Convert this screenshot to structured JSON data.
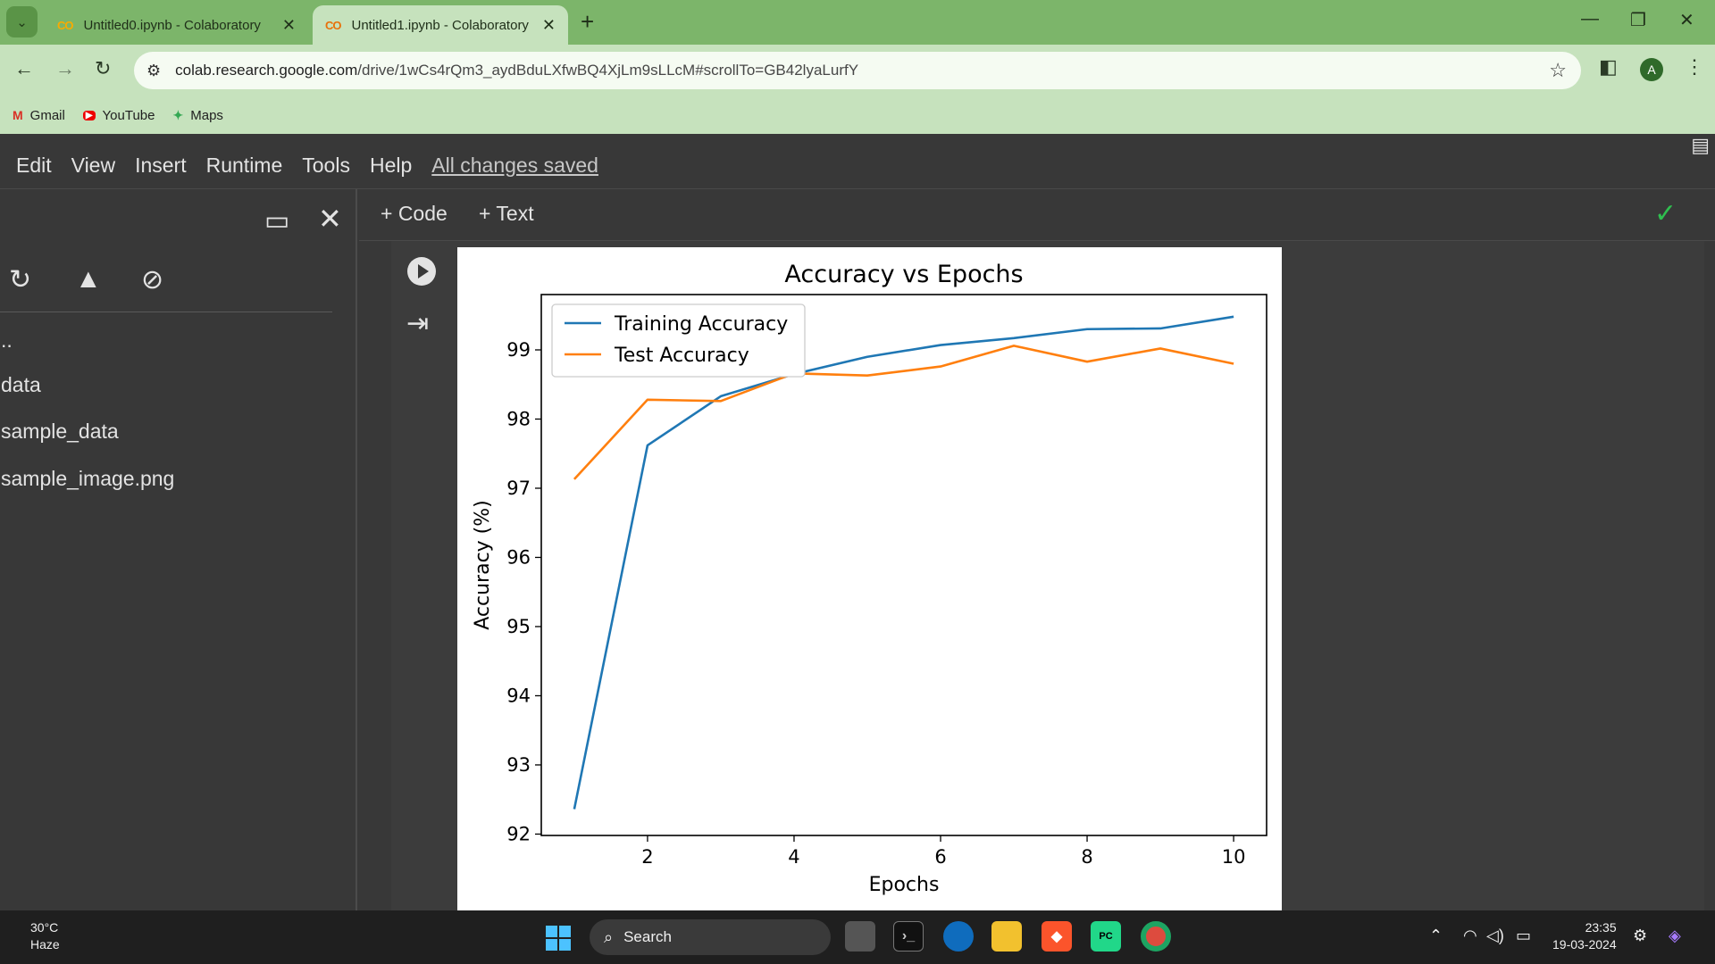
{
  "browser": {
    "tabs": [
      {
        "title": "Untitled0.ipynb - Colaboratory",
        "favicon": "CO"
      },
      {
        "title": "Untitled1.ipynb - Colaboratory",
        "favicon": "CO"
      }
    ],
    "address": {
      "host": "colab.research.google.com",
      "path": "/drive/1wCs4rQm3_aydBduLXfwBQ4XjLm9sLLcM#scrollTo=GB42lyaLurfY"
    },
    "profile_initial": "A",
    "bookmarks": [
      {
        "label": "Gmail",
        "icon": "M"
      },
      {
        "label": "YouTube",
        "icon": "▶"
      },
      {
        "label": "Maps",
        "icon": "✦"
      }
    ]
  },
  "colab": {
    "menu": [
      "Edit",
      "View",
      "Insert",
      "Runtime",
      "Tools",
      "Help"
    ],
    "save_status": "All changes saved",
    "toolbar": {
      "code_label": "+ Code",
      "text_label": "+ Text"
    },
    "files": [
      "..",
      "data",
      "sample_data",
      "sample_image.png"
    ]
  },
  "chart_data": {
    "type": "line",
    "title": "Accuracy vs Epochs",
    "xlabel": "Epochs",
    "ylabel": "Accuracy (%)",
    "x": [
      1,
      2,
      3,
      4,
      5,
      6,
      7,
      8,
      9,
      10
    ],
    "xlim": [
      0.55,
      10.45
    ],
    "ylim": [
      91.98,
      99.8
    ],
    "xticks": [
      2,
      4,
      6,
      8,
      10
    ],
    "yticks": [
      92,
      93,
      94,
      95,
      96,
      97,
      98,
      99
    ],
    "legend_position": "upper left",
    "series": [
      {
        "name": "Training Accuracy",
        "color": "#1f77b4",
        "values": [
          92.36,
          97.62,
          98.33,
          98.65,
          98.9,
          99.07,
          99.17,
          99.3,
          99.31,
          99.48
        ]
      },
      {
        "name": "Test Accuracy",
        "color": "#ff7f0e",
        "values": [
          97.13,
          98.28,
          98.26,
          98.66,
          98.63,
          98.76,
          99.06,
          98.83,
          99.02,
          98.8
        ]
      }
    ]
  },
  "taskbar": {
    "weather_temp": "30°C",
    "weather_desc": "Haze",
    "search_label": "Search",
    "time": "23:35",
    "date": "19-03-2024"
  }
}
